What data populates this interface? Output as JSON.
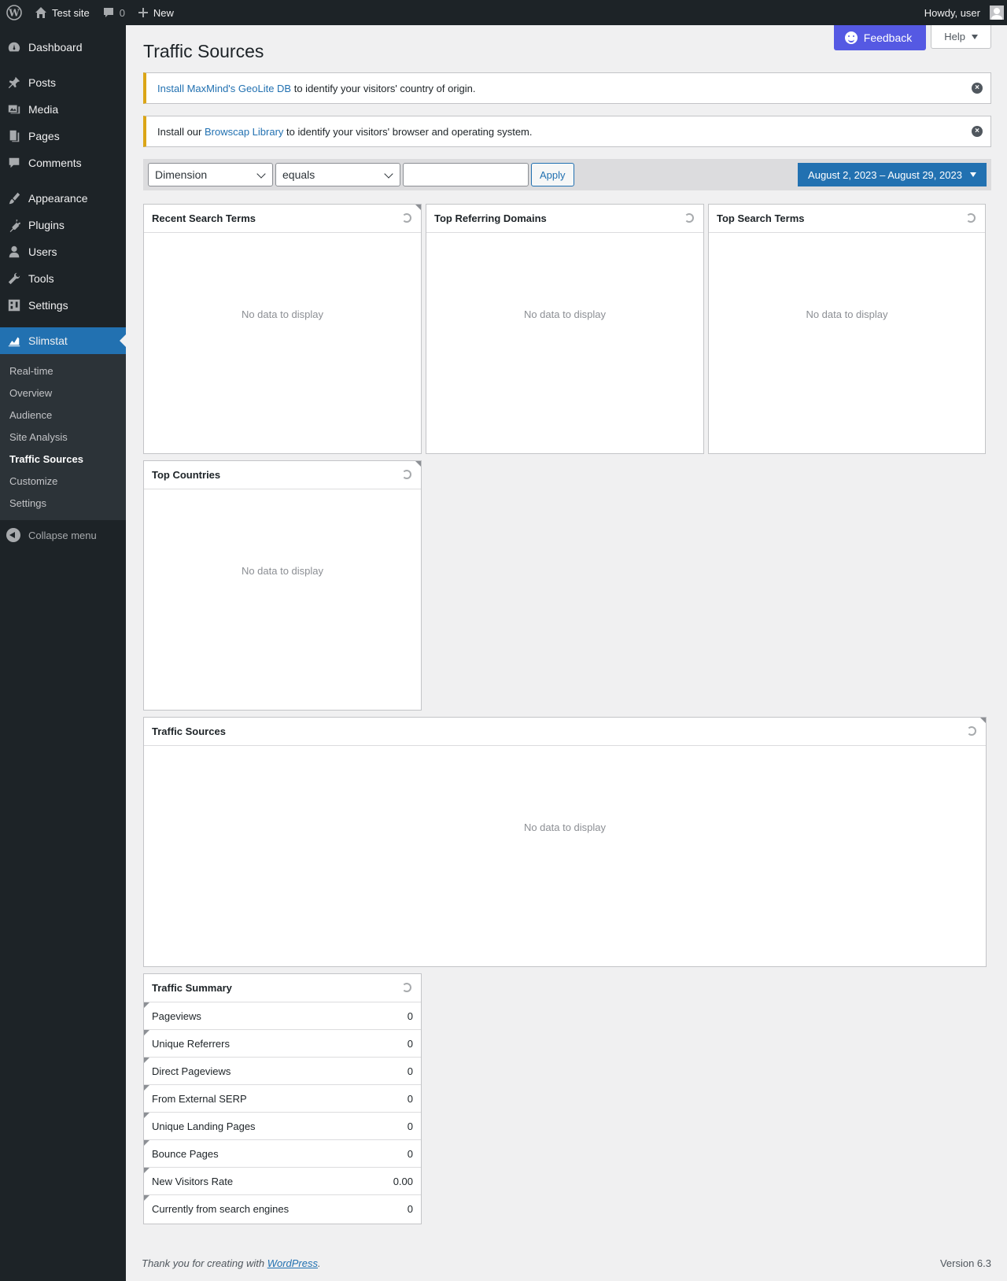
{
  "adminbar": {
    "site_name": "Test site",
    "comments_count": "0",
    "new_label": "New",
    "howdy": "Howdy, user"
  },
  "sidebar": {
    "items": [
      {
        "label": "Dashboard",
        "icon": "dashboard-icon"
      },
      {
        "label": "Posts",
        "icon": "pin-icon"
      },
      {
        "label": "Media",
        "icon": "media-icon"
      },
      {
        "label": "Pages",
        "icon": "pages-icon"
      },
      {
        "label": "Comments",
        "icon": "comment-icon"
      },
      {
        "label": "Appearance",
        "icon": "brush-icon"
      },
      {
        "label": "Plugins",
        "icon": "plug-icon"
      },
      {
        "label": "Users",
        "icon": "user-icon"
      },
      {
        "label": "Tools",
        "icon": "wrench-icon"
      },
      {
        "label": "Settings",
        "icon": "settings-icon"
      },
      {
        "label": "Slimstat",
        "icon": "chart-icon"
      }
    ],
    "submenu": [
      "Real-time",
      "Overview",
      "Audience",
      "Site Analysis",
      "Traffic Sources",
      "Customize",
      "Settings"
    ],
    "collapse_label": "Collapse menu"
  },
  "header": {
    "feedback_label": "Feedback",
    "help_label": "Help",
    "title": "Traffic Sources"
  },
  "notices": [
    {
      "link": "Install MaxMind's GeoLite DB",
      "prefix": "",
      "text": " to identify your visitors' country of origin."
    },
    {
      "prefix": "Install our ",
      "link": "Browscap Library",
      "text": " to identify your visitors' browser and operating system."
    }
  ],
  "filters": {
    "dimension": "Dimension",
    "operator": "equals",
    "value": "",
    "apply_label": "Apply",
    "date_range": "August 2, 2023 – August 29, 2023"
  },
  "no_data": "No data to display",
  "reports": {
    "recent_search_terms": "Recent Search Terms",
    "top_referring_domains": "Top Referring Domains",
    "top_search_terms": "Top Search Terms",
    "top_countries": "Top Countries",
    "traffic_sources": "Traffic Sources",
    "traffic_summary": "Traffic Summary"
  },
  "summary_rows": [
    {
      "label": "Pageviews",
      "value": "0"
    },
    {
      "label": "Unique Referrers",
      "value": "0"
    },
    {
      "label": "Direct Pageviews",
      "value": "0"
    },
    {
      "label": "From External SERP",
      "value": "0"
    },
    {
      "label": "Unique Landing Pages",
      "value": "0"
    },
    {
      "label": "Bounce Pages",
      "value": "0"
    },
    {
      "label": "New Visitors Rate",
      "value": "0.00"
    },
    {
      "label": "Currently from search engines",
      "value": "0"
    }
  ],
  "footer": {
    "thanks_prefix": "Thank you for creating with ",
    "thanks_link": "WordPress",
    "thanks_suffix": ".",
    "version": "Version 6.3"
  }
}
